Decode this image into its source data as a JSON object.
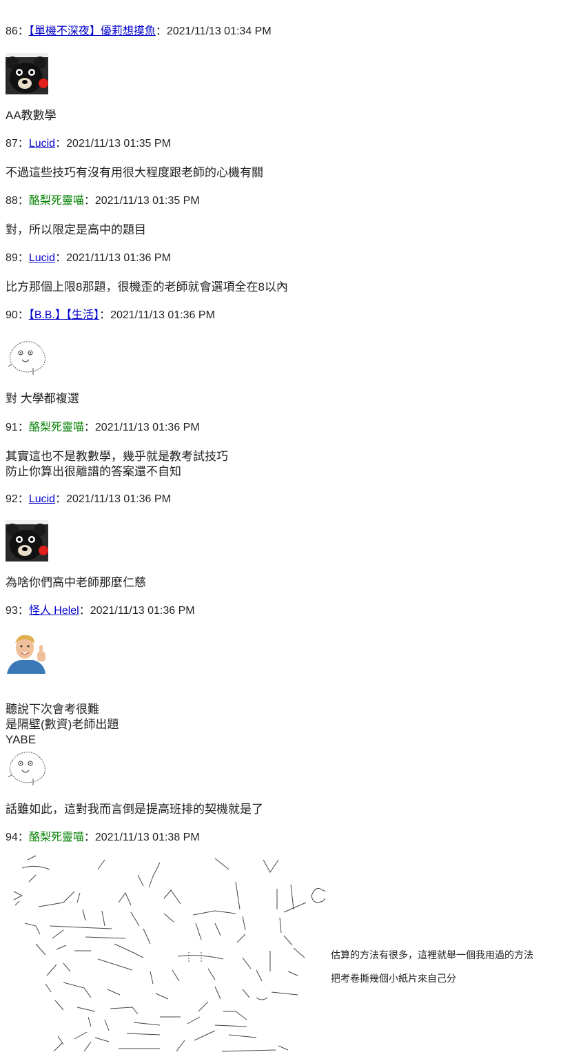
{
  "posts": [
    {
      "num": "86",
      "name": "【單機不深夜】優莉想摸魚",
      "name_style": "link",
      "datetime": "2021/11/13 01:34 PM",
      "image": "bear-avatar",
      "lines": [
        "AA教數學"
      ]
    },
    {
      "num": "87",
      "name": "Lucid",
      "name_style": "link",
      "datetime": "2021/11/13 01:35 PM",
      "lines": [
        "不過這些技巧有沒有用很大程度跟老師的心機有關"
      ]
    },
    {
      "num": "88",
      "name": "酪梨死靈喵",
      "name_style": "green",
      "datetime": "2021/11/13 01:35 PM",
      "lines": [
        "對，所以限定是高中的題目"
      ]
    },
    {
      "num": "89",
      "name": "Lucid",
      "name_style": "link",
      "datetime": "2021/11/13 01:36 PM",
      "lines": [
        "比方那個上限8那題，很機歪的老師就會選項全在8以內"
      ]
    },
    {
      "num": "90",
      "name": "【B.B.】【生活】",
      "name_style": "link",
      "datetime": "2021/11/13 01:36 PM",
      "image": "doodle-face",
      "lines": [
        "對 大學都複選"
      ]
    },
    {
      "num": "91",
      "name": "酪梨死靈喵",
      "name_style": "green",
      "datetime": "2021/11/13 01:36 PM",
      "lines": [
        "其實這也不是教數學，幾乎就是教考試技巧",
        "防止你算出很離譜的答案還不自知"
      ]
    },
    {
      "num": "92",
      "name": "Lucid",
      "name_style": "link",
      "datetime": "2021/11/13 01:36 PM",
      "image": "bear-avatar",
      "lines": [
        "為啥你們高中老師那麼仁慈"
      ]
    },
    {
      "num": "93",
      "name": "怪人 Helel",
      "name_style": "link",
      "datetime": "2021/11/13 01:36 PM",
      "image": "thumbs-up-man",
      "lines": [
        "聽說下次會考很難",
        "是隔壁(數資)老師出題",
        "YABE"
      ],
      "image2": "doodle-face",
      "lines2": [
        "話雖如此，這對我而言倒是提高班排的契機就是了"
      ]
    },
    {
      "num": "94",
      "name": "酪梨死靈喵",
      "name_style": "green",
      "datetime": "2021/11/13 01:38 PM",
      "ascii_art": "ascii-art-character",
      "aa_text": [
        "估算的方法有很多，這裡就舉一個我用過的方法",
        "把考卷撕幾個小紙片來自己分"
      ]
    }
  ],
  "separator": "："
}
